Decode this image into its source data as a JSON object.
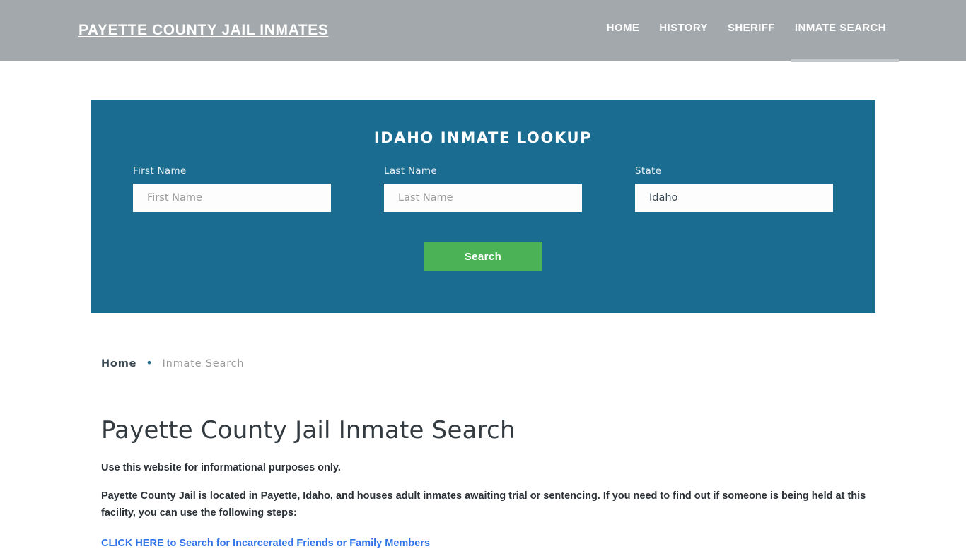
{
  "header": {
    "brand": "Payette County Jail Inmates",
    "nav": [
      {
        "label": "Home",
        "active": false
      },
      {
        "label": "History",
        "active": false
      },
      {
        "label": "Sheriff",
        "active": false
      },
      {
        "label": "Inmate Search",
        "active": true
      }
    ]
  },
  "lookup": {
    "title": "Idaho Inmate Lookup",
    "panel_color": "#1a6d91",
    "fields": {
      "first": {
        "label": "First Name",
        "value": "",
        "placeholder": "First Name"
      },
      "last": {
        "label": "Last Name",
        "value": "",
        "placeholder": "Last Name"
      },
      "state": {
        "label": "State",
        "value": "Idaho",
        "options": [
          "Idaho"
        ]
      }
    },
    "search_button": "Search",
    "search_button_color": "#4cb256"
  },
  "breadcrumb": {
    "home": "Home",
    "separator": "•",
    "current": "Inmate Search"
  },
  "main": {
    "title": "Payette County Jail Inmate Search",
    "lead": "Use this website for informational purposes only.",
    "paragraph": "Payette County Jail is located in Payette, Idaho, and houses adult inmates awaiting trial or sentencing. If you need to find out if someone is being held at this facility, you can use the following steps:",
    "cta_link": "CLICK HERE to Search for Incarcerated Friends or Family Members",
    "cta_link_color": "#2e72e8"
  }
}
